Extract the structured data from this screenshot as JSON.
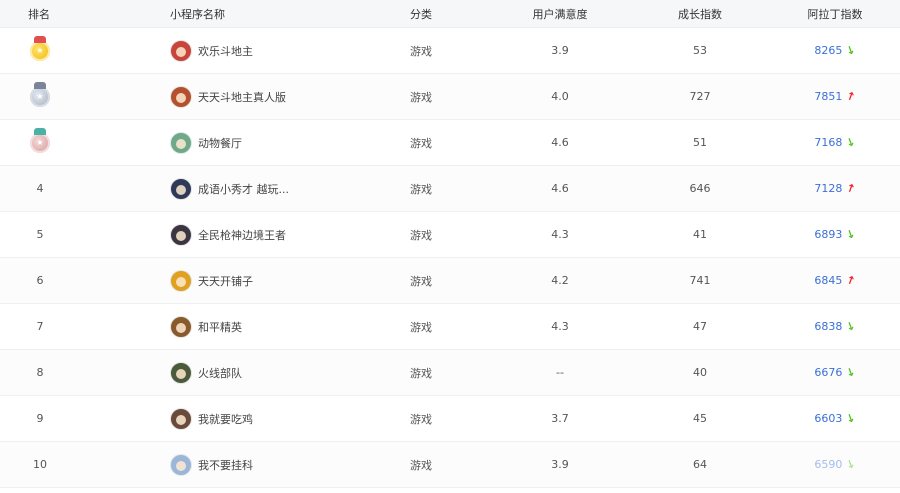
{
  "header": {
    "rank": "排名",
    "name": "小程序名称",
    "category": "分类",
    "satisfaction": "用户满意度",
    "growth": "成长指数",
    "aladdin": "阿拉丁指数"
  },
  "rows": [
    {
      "rank": "",
      "medal": "gold",
      "name": "欢乐斗地主",
      "category": "游戏",
      "satisfaction": "3.9",
      "growth": "53",
      "index": "8265",
      "trend": "down",
      "avatar_color": "#c9453b"
    },
    {
      "rank": "",
      "medal": "silver",
      "name": "天天斗地主真人版",
      "category": "游戏",
      "satisfaction": "4.0",
      "growth": "727",
      "index": "7851",
      "trend": "up",
      "avatar_color": "#b5502e"
    },
    {
      "rank": "",
      "medal": "bronze",
      "name": "动物餐厅",
      "category": "游戏",
      "satisfaction": "4.6",
      "growth": "51",
      "index": "7168",
      "trend": "down",
      "avatar_color": "#6ea98a"
    },
    {
      "rank": "4",
      "medal": "",
      "name": "成语小秀才 越玩...",
      "category": "游戏",
      "satisfaction": "4.6",
      "growth": "646",
      "index": "7128",
      "trend": "up",
      "avatar_color": "#2f3a58"
    },
    {
      "rank": "5",
      "medal": "",
      "name": "全民枪神边境王者",
      "category": "游戏",
      "satisfaction": "4.3",
      "growth": "41",
      "index": "6893",
      "trend": "down",
      "avatar_color": "#3a3540"
    },
    {
      "rank": "6",
      "medal": "",
      "name": "天天开铺子",
      "category": "游戏",
      "satisfaction": "4.2",
      "growth": "741",
      "index": "6845",
      "trend": "up",
      "avatar_color": "#e0a020"
    },
    {
      "rank": "7",
      "medal": "",
      "name": "和平精英",
      "category": "游戏",
      "satisfaction": "4.3",
      "growth": "47",
      "index": "6838",
      "trend": "down",
      "avatar_color": "#8a5a2a"
    },
    {
      "rank": "8",
      "medal": "",
      "name": "火线部队",
      "category": "游戏",
      "satisfaction": "--",
      "growth": "40",
      "index": "6676",
      "trend": "down",
      "avatar_color": "#4a5a3a"
    },
    {
      "rank": "9",
      "medal": "",
      "name": "我就要吃鸡",
      "category": "游戏",
      "satisfaction": "3.7",
      "growth": "45",
      "index": "6603",
      "trend": "down",
      "avatar_color": "#6a4a3a"
    },
    {
      "rank": "10",
      "medal": "",
      "name": "我不要挂科",
      "category": "游戏",
      "satisfaction": "3.9",
      "growth": "64",
      "index": "6590",
      "trend": "down",
      "avatar_color": "#9bb6d8"
    }
  ],
  "colors": {
    "index_link": "#3b6fd8",
    "trend_up": "#f5222d",
    "trend_down": "#52c41a"
  },
  "icons": {
    "trend_up": "up-arrow-icon",
    "trend_down": "down-arrow-icon",
    "medal_gold": "gold-medal-icon",
    "medal_silver": "silver-medal-icon",
    "medal_bronze": "bronze-medal-icon"
  }
}
